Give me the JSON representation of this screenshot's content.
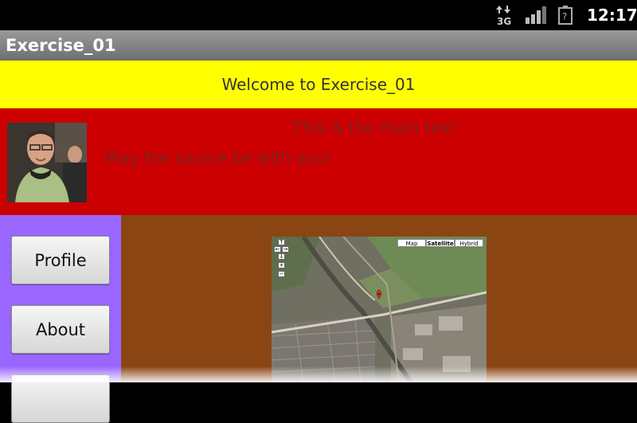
{
  "status_bar": {
    "network_label": "3G",
    "time": "12:17",
    "icons": [
      "data-3g-icon",
      "signal-icon",
      "battery-unknown-icon"
    ]
  },
  "app": {
    "title": "Exercise_01"
  },
  "header": {
    "welcome": "Welcome to Exercise_01"
  },
  "intro": {
    "main_text": "This is the main text",
    "quote": "May the source be with you!"
  },
  "nav": {
    "profile_label": "Profile",
    "about_label": "About"
  },
  "map": {
    "types": [
      "Map",
      "Satellite",
      "Hybrid"
    ],
    "selected_type": "Satellite"
  },
  "colors": {
    "welcome_bg": "#ffff00",
    "intro_bg": "#cc0000",
    "nav_bg": "#9966ff",
    "content_bg": "#8b4513"
  }
}
